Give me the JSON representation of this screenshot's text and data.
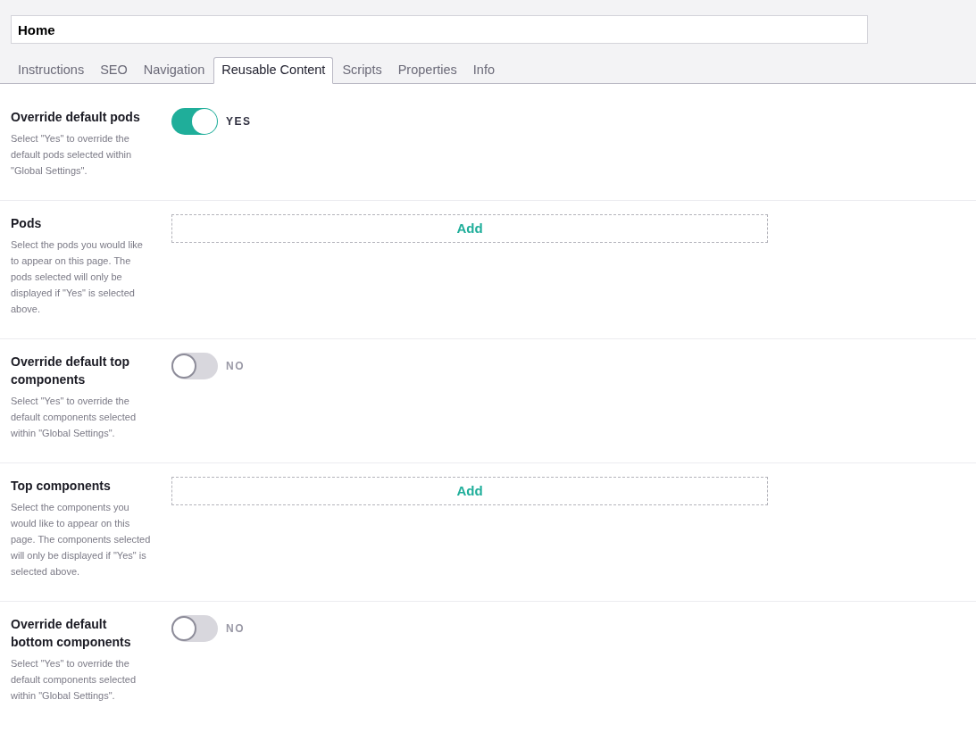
{
  "page_title": {
    "value": "Home"
  },
  "tabs": [
    {
      "label": "Instructions",
      "selected": false
    },
    {
      "label": "SEO",
      "selected": false
    },
    {
      "label": "Navigation",
      "selected": false
    },
    {
      "label": "Reusable Content",
      "selected": true
    },
    {
      "label": "Scripts",
      "selected": false
    },
    {
      "label": "Properties",
      "selected": false
    },
    {
      "label": "Info",
      "selected": false
    }
  ],
  "fields": [
    {
      "kind": "toggle",
      "label": "Override default pods",
      "description": "Select \"Yes\" to override the default pods selected within \"Global Settings\".",
      "on": true,
      "state_label": "YES"
    },
    {
      "kind": "picker",
      "label": "Pods",
      "description": "Select the pods you would like to appear on this page. The pods selected will only be displayed if \"Yes\" is selected above.",
      "button": "Add"
    },
    {
      "kind": "toggle",
      "label": "Override default top components",
      "description": "Select \"Yes\" to override the default components selected within \"Global Settings\".",
      "on": false,
      "state_label": "NO"
    },
    {
      "kind": "picker",
      "label": "Top components",
      "description": "Select the components you would like to appear on this page. The components selected will only be displayed if \"Yes\" is selected above.",
      "button": "Add"
    },
    {
      "kind": "toggle",
      "label": "Override default bottom components",
      "description": "Select \"Yes\" to override the default components selected within \"Global Settings\".",
      "on": false,
      "state_label": "NO"
    }
  ]
}
